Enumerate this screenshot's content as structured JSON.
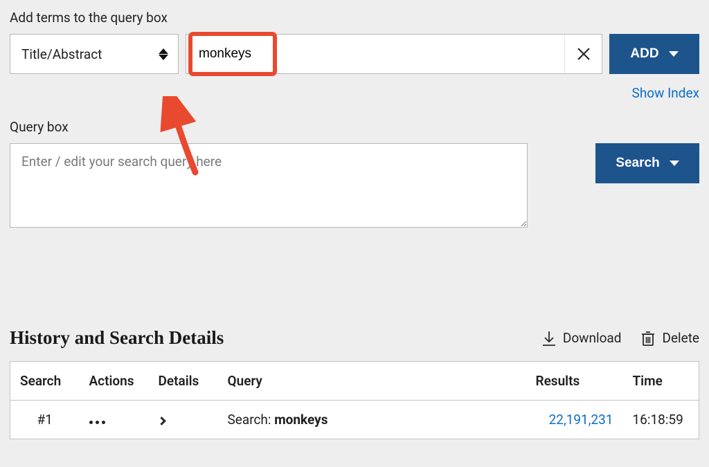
{
  "addTerms": {
    "label": "Add terms to the query box",
    "fieldSelect": "Title/Abstract",
    "termInput": "monkeys",
    "addBtn": "ADD",
    "showIndex": "Show Index"
  },
  "queryBox": {
    "label": "Query box",
    "placeholder": "Enter / edit your search query here",
    "value": "",
    "searchBtn": "Search"
  },
  "history": {
    "title": "History and Search Details",
    "downloadLabel": "Download",
    "deleteLabel": "Delete",
    "columns": {
      "search": "Search",
      "actions": "Actions",
      "details": "Details",
      "query": "Query",
      "results": "Results",
      "time": "Time"
    },
    "rows": [
      {
        "search": "#1",
        "queryPrefix": "Search: ",
        "queryTerm": "monkeys",
        "results": "22,191,231",
        "time": "16:18:59"
      }
    ]
  }
}
